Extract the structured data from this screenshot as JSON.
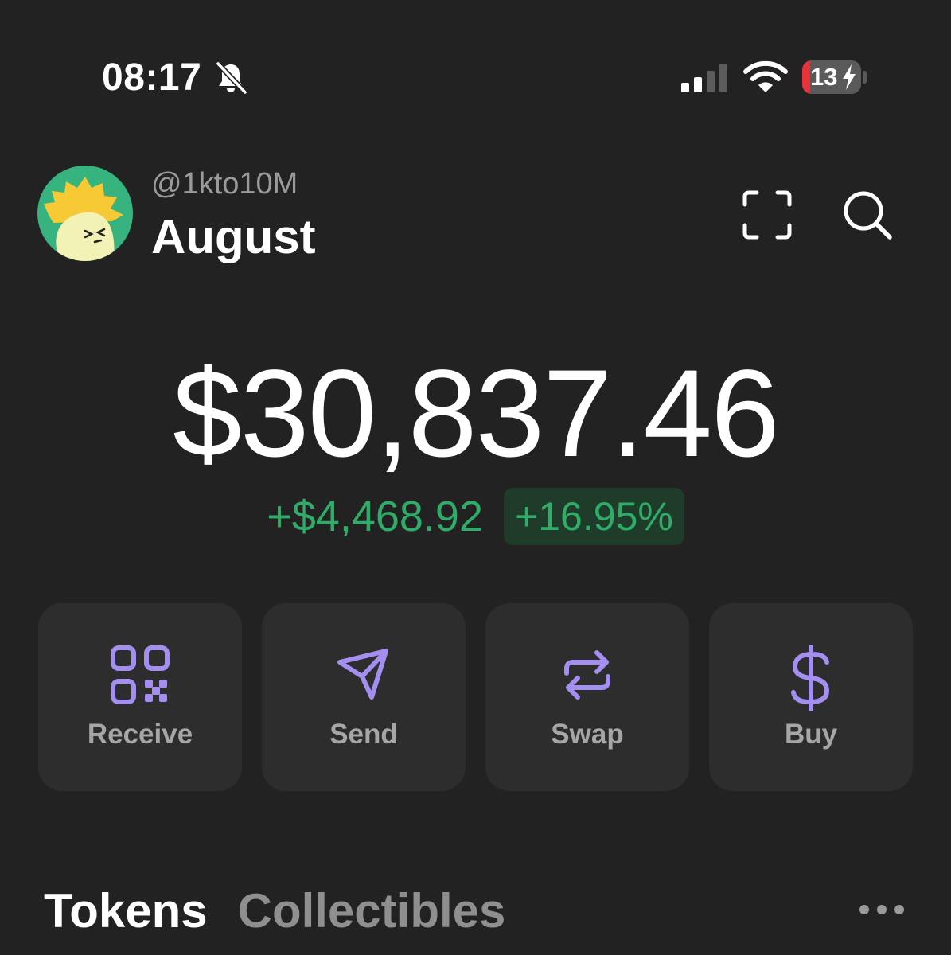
{
  "status_bar": {
    "time": "08:17",
    "battery_text": "13",
    "battery_level_percent": 13,
    "silent_icon": "bell-slash-icon",
    "signal_icon": "cellular-signal-icon",
    "wifi_icon": "wifi-icon"
  },
  "header": {
    "handle": "@1kto10M",
    "account_name": "August",
    "avatar_icon": "account-avatar",
    "scan_icon": "scan-frame-icon",
    "search_icon": "search-icon"
  },
  "balance": {
    "total": "$30,837.46",
    "change_amount": "+$4,468.92",
    "change_percent": "+16.95%"
  },
  "actions": [
    {
      "label": "Receive",
      "icon": "qr-code-icon"
    },
    {
      "label": "Send",
      "icon": "paper-plane-icon"
    },
    {
      "label": "Swap",
      "icon": "swap-arrows-icon"
    },
    {
      "label": "Buy",
      "icon": "dollar-sign-icon"
    }
  ],
  "tabs": [
    {
      "label": "Tokens",
      "active": true
    },
    {
      "label": "Collectibles",
      "active": false
    }
  ],
  "more_icon": "more-horizontal-icon",
  "colors": {
    "background": "#222222",
    "card": "#2d2d2d",
    "accent": "#a48ef0",
    "positive": "#2fac67",
    "positive_bg": "#1f3b2a",
    "muted": "#9a9a9a",
    "battery_low": "#e8323a",
    "avatar_bg": "#36b37e"
  }
}
